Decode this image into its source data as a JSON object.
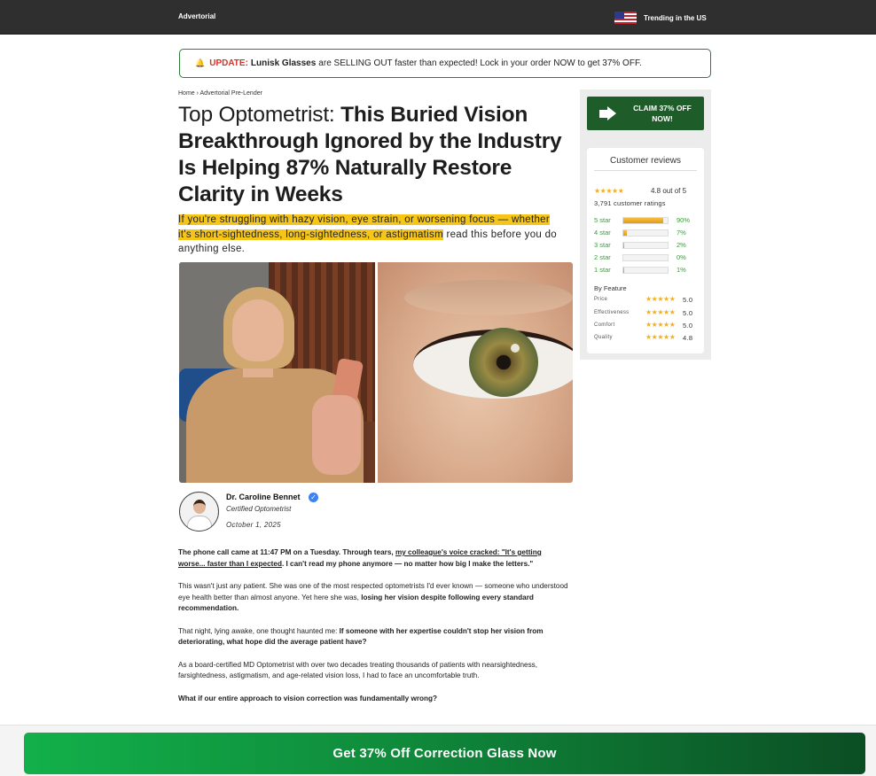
{
  "topbar": {
    "brand": "Advertorial",
    "trending": "Trending in the US",
    "flag_icon": "us-flag-icon"
  },
  "update_banner": {
    "icon": "bell-icon",
    "label": "UPDATE:",
    "product": "Lunisk Glasses",
    "text": "are SELLING OUT faster than expected! Lock in your order NOW to get 37% OFF."
  },
  "breadcrumb": "Home › Advertorial Pre-Lender",
  "headline": {
    "light": "Top Optometrist:",
    "bold": "This Buried Vision Breakthrough Ignored by the Industry Is Helping 87% Naturally Restore Clarity in Weeks"
  },
  "subhead": {
    "highlighted": "If you're struggling with hazy vision, eye strain, or worsening focus — whether it's short-sightedness, long-sightedness, or astigmatism",
    "rest": "read this before you do anything else."
  },
  "author": {
    "name": "Dr. Caroline Bennet",
    "role": "Certified Optometrist",
    "date": "October 1, 2025",
    "verified_icon": "verified-check-icon"
  },
  "article": {
    "p1_bold_a": "The phone call came at 11:47 PM on a Tuesday. Through tears,",
    "p1_underline": "my colleague's voice cracked: \"It's getting worse... faster than I expected",
    "p1_bold_b": ". I can't read my phone anymore — no matter how big I make the letters.\"",
    "p2_text": "This wasn't just any patient. She was one of the most respected optometrists I'd ever known — someone who understood eye health better than almost anyone. Yet here she was,",
    "p2_bold": "losing her vision despite following every standard recommendation.",
    "p3_text": "That night, lying awake, one thought haunted me:",
    "p3_bold": "If someone with her expertise couldn't stop her vision from deteriorating, what hope did the average patient have?",
    "p4_text": "As a board-certified MD Optometrist with over two decades treating thousands of patients with nearsightedness, farsightedness, astigmatism, and age-related vision loss, I had to face an uncomfortable truth.",
    "p5_bold": "What if our entire approach to vision correction was fundamentally wrong?"
  },
  "sidebar": {
    "claim_label": "CLAIM 37% OFF NOW!",
    "claim_icon": "arrow-right-icon",
    "reviews_title": "Customer reviews",
    "stars_glyph": "★★★★★",
    "average": "4.8 out of 5",
    "ratings_count": "3,791 customer ratings",
    "histogram": [
      {
        "label": "5 star",
        "percent": 90,
        "percent_text": "90%"
      },
      {
        "label": "4 star",
        "percent": 7,
        "percent_text": "7%"
      },
      {
        "label": "3 star",
        "percent": 2,
        "percent_text": "2%"
      },
      {
        "label": "2 star",
        "percent": 0,
        "percent_text": "0%"
      },
      {
        "label": "1 star",
        "percent": 1,
        "percent_text": "1%"
      }
    ],
    "by_feature_title": "By Feature",
    "features": [
      {
        "name": "Price",
        "value": "5.0"
      },
      {
        "name": "Effectiveness",
        "value": "5.0"
      },
      {
        "name": "Comfort",
        "value": "5.0"
      },
      {
        "name": "Quality",
        "value": "4.8"
      }
    ]
  },
  "cta": {
    "label": "Get 37% Off Correction Glass Now"
  },
  "colors": {
    "topbar": "#2f2f2f",
    "accent_green": "#1e5c2a",
    "cta_green": "#12b04a",
    "highlight": "#f5c518",
    "star": "#f2b01e",
    "alert_red": "#d93025"
  }
}
